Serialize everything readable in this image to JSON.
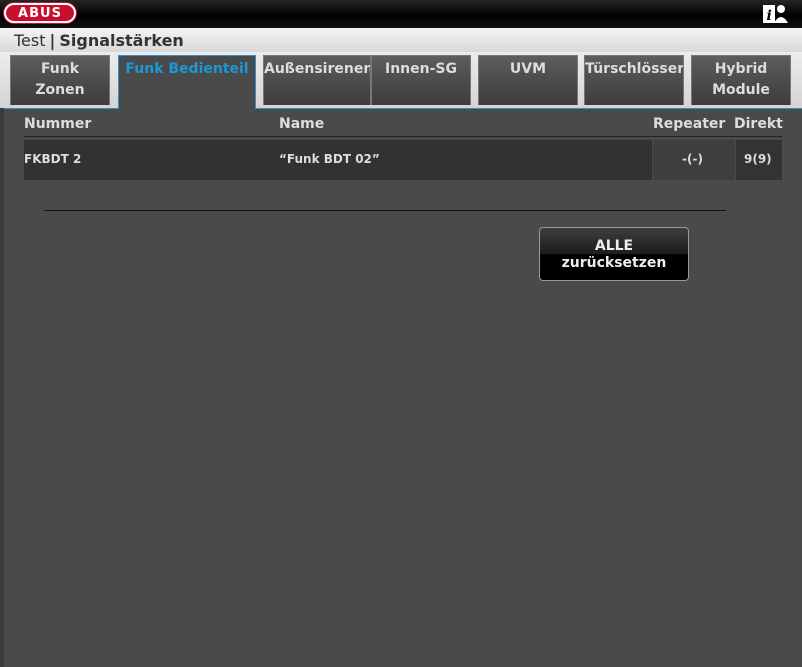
{
  "header": {
    "logo_text": "ABUS",
    "info_icon": "info-user-icon"
  },
  "titlebar": {
    "context": "Test",
    "separator": "|",
    "page_title": "Signalstärken"
  },
  "tabs": [
    {
      "line1": "Funk",
      "line2": "Zonen",
      "active": false
    },
    {
      "line1": "Funk Bedienteil",
      "line2": "",
      "active": true
    },
    {
      "line1": "Außensirenen",
      "line2": "",
      "active": false
    },
    {
      "line1": "Innen-SG",
      "line2": "",
      "active": false
    },
    {
      "line1": "UVM",
      "line2": "",
      "active": false
    },
    {
      "line1": "Türschlösser",
      "line2": "",
      "active": false
    },
    {
      "line1": "Hybrid",
      "line2": "Module",
      "active": false
    }
  ],
  "table": {
    "columns": {
      "number": "Nummer",
      "name": "Name",
      "repeater": "Repeater",
      "direct": "Direkt"
    },
    "rows": [
      {
        "number": "FKBDT 2",
        "name": "“Funk BDT 02”",
        "repeater": "-(-)",
        "direct": "9(9)"
      }
    ]
  },
  "reset_button": {
    "line1": "ALLE",
    "line2": "zurücksetzen"
  },
  "colors": {
    "accent": "#1a98d8",
    "brand_red": "#c8102e",
    "background": "#4a4a4a"
  }
}
